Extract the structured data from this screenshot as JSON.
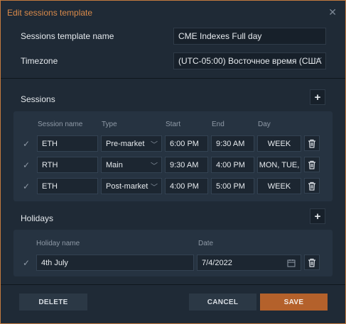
{
  "dialog": {
    "title": "Edit sessions template",
    "close_glyph": "✕"
  },
  "form": {
    "name_label": "Sessions template name",
    "name_value": "CME Indexes Full day",
    "timezone_label": "Timezone",
    "timezone_value": "(UTC-05:00) Восточное время (США"
  },
  "sessions": {
    "title": "Sessions",
    "add_glyph": "+",
    "columns": [
      "Session name",
      "Type",
      "Start",
      "End",
      "Day"
    ],
    "rows": [
      {
        "name": "ETH",
        "type": "Pre-market",
        "start": "6:00 PM",
        "end": "9:30 AM",
        "day": "WEEK"
      },
      {
        "name": "RTH",
        "type": "Main",
        "start": "9:30 AM",
        "end": "4:00 PM",
        "day": "MON, TUE,"
      },
      {
        "name": "ETH",
        "type": "Post-market",
        "start": "4:00 PM",
        "end": "5:00 PM",
        "day": "WEEK"
      }
    ]
  },
  "holidays": {
    "title": "Holidays",
    "add_glyph": "+",
    "columns": [
      "Holiday name",
      "Date"
    ],
    "rows": [
      {
        "name": "4th July",
        "date": "7/4/2022"
      }
    ]
  },
  "footer": {
    "delete_label": "DELETE",
    "cancel_label": "CANCEL",
    "save_label": "SAVE"
  },
  "icons": {
    "check": "✓",
    "chevron": "﹀",
    "trash": "trash-icon",
    "calendar": "calendar-icon"
  },
  "colors": {
    "accent": "#d98a4a",
    "primary_button": "#b4612b",
    "background": "#1f2a36",
    "panel": "#263341"
  }
}
